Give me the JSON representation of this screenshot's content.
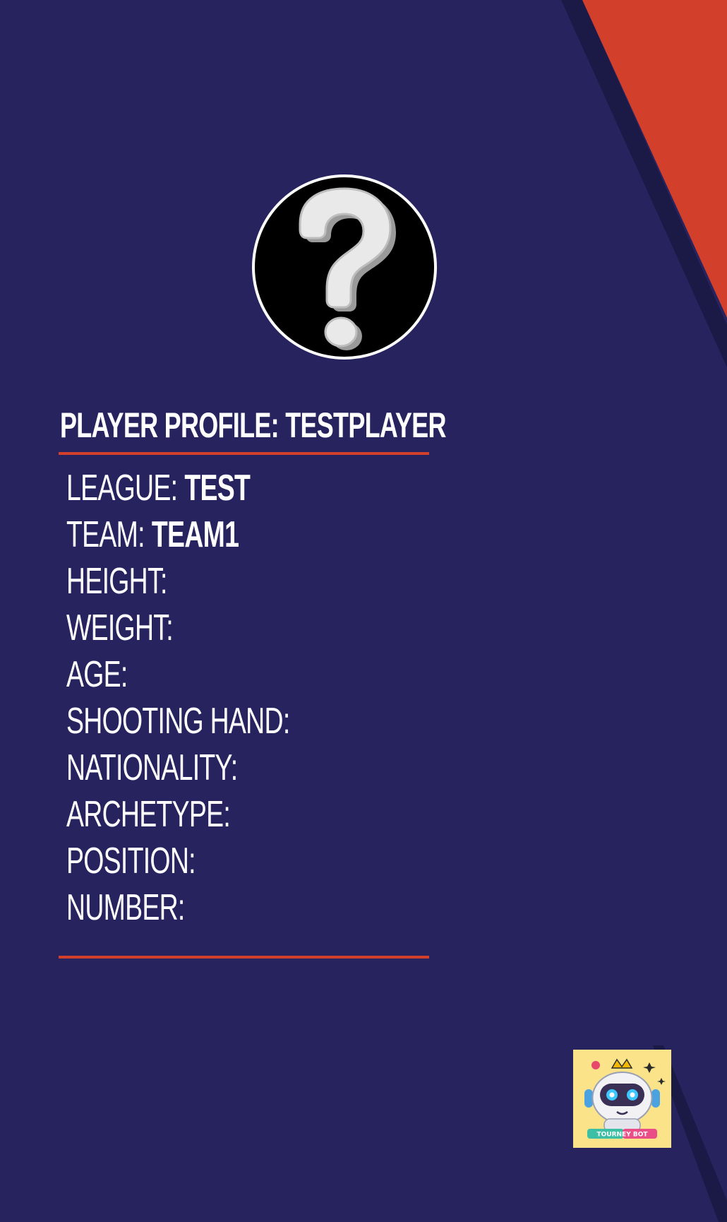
{
  "profile": {
    "title": "PLAYER PROFILE: TESTPLAYER",
    "fields": [
      {
        "label": "LEAGUE:",
        "value": "TEST"
      },
      {
        "label": "TEAM:",
        "value": "TEAM1"
      },
      {
        "label": "HEIGHT:",
        "value": ""
      },
      {
        "label": "WEIGHT:",
        "value": ""
      },
      {
        "label": "AGE:",
        "value": ""
      },
      {
        "label": "SHOOTING HAND:",
        "value": ""
      },
      {
        "label": "NATIONALITY:",
        "value": ""
      },
      {
        "label": "ARCHETYPE:",
        "value": ""
      },
      {
        "label": "POSITION:",
        "value": ""
      },
      {
        "label": "NUMBER:",
        "value": ""
      }
    ]
  },
  "avatar": {
    "icon": "question-mark-icon"
  },
  "logo": {
    "icon": "tourney-bot-robot-icon",
    "text": "TOURNEY BOT"
  },
  "colors": {
    "background": "#26235f",
    "accent": "#d23f2b",
    "stripe_dark": "#1b1946",
    "text": "#ffffff"
  }
}
